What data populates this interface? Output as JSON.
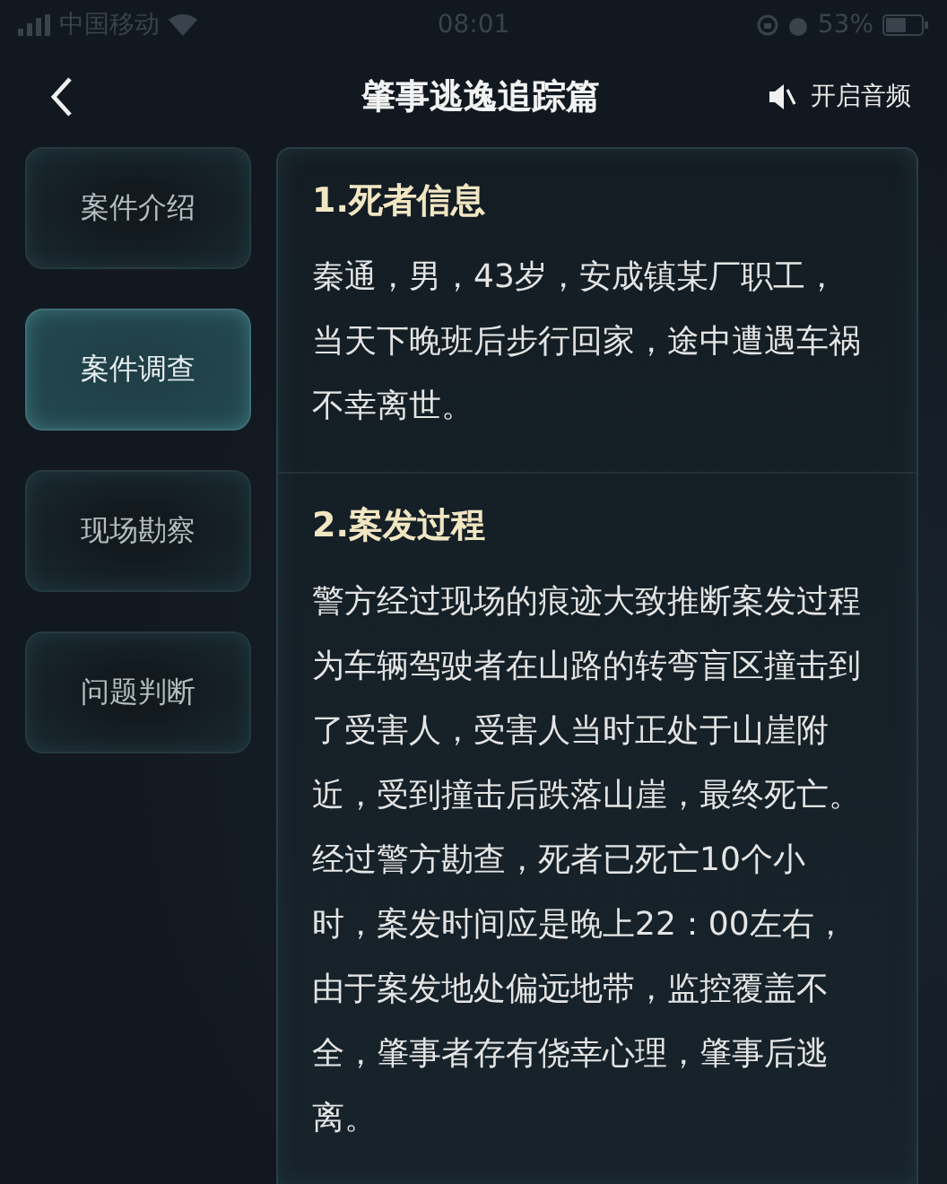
{
  "status_bar": {
    "carrier": "中国移动",
    "time": "08:01",
    "battery": "53%"
  },
  "header": {
    "title": "肇事逃逸追踪篇",
    "audio_label": "开启音频"
  },
  "sidebar": {
    "items": [
      {
        "label": "案件介绍",
        "selected": false
      },
      {
        "label": "案件调查",
        "selected": true
      },
      {
        "label": "现场勘察",
        "selected": false
      },
      {
        "label": "问题判断",
        "selected": false
      }
    ]
  },
  "sections": [
    {
      "heading": "1.死者信息",
      "body": "秦通，男，43岁，安成镇某厂职工，当天下晚班后步行回家，途中遭遇车祸不幸离世。"
    },
    {
      "heading": "2.案发过程",
      "body": "警方经过现场的痕迹大致推断案发过程为车辆驾驶者在山路的转弯盲区撞击到了受害人，受害人当时正处于山崖附近，受到撞击后跌落山崖，最终死亡。经过警方勘查，死者已死亡10个小时，案发时间应是晚上22：00左右，由于案发地处偏远地带，监控覆盖不全，肇事者存有侥幸心理，肇事后逃离。"
    }
  ]
}
